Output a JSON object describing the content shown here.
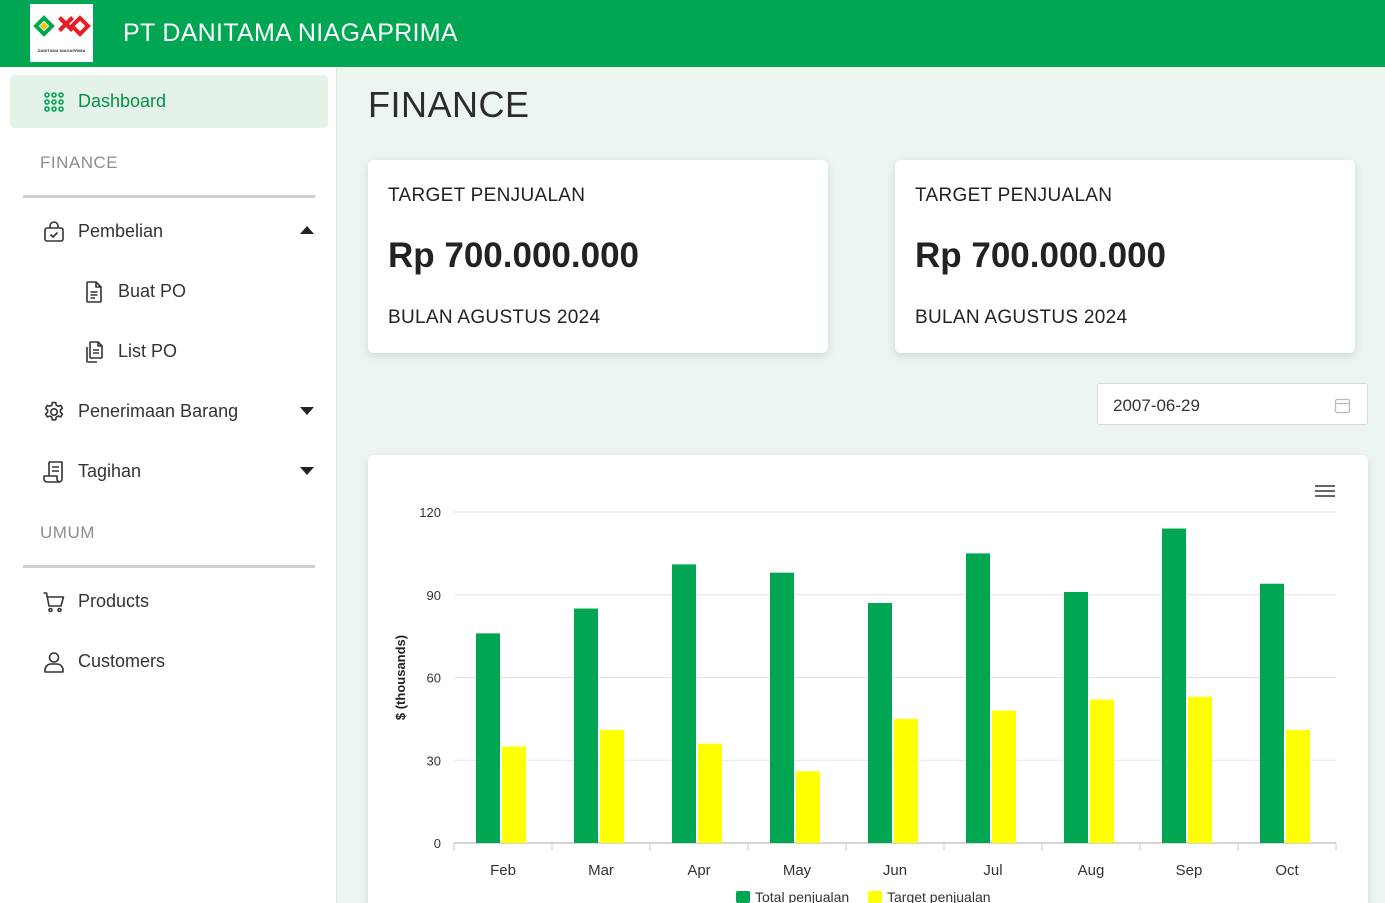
{
  "app": {
    "company_name": "PT DANITAMA NIAGAPRIMA",
    "logo_caption": "DANITAMA NIAGAPRIMA",
    "brand_color": "#00a651"
  },
  "sidebar": {
    "dashboard": {
      "label": "Dashboard",
      "icon": "grid-dots-icon"
    },
    "section_finance": "FINANCE",
    "pembelian": {
      "label": "Pembelian",
      "icon": "shopping-bag-icon",
      "expanded": true
    },
    "buat_po": {
      "label": "Buat PO",
      "icon": "document-icon"
    },
    "list_po": {
      "label": "List PO",
      "icon": "documents-copy-icon"
    },
    "penerimaan": {
      "label": "Penerimaan Barang",
      "icon": "gear-icon",
      "expanded": false
    },
    "tagihan": {
      "label": "Tagihan",
      "icon": "invoice-icon",
      "expanded": false
    },
    "section_umum": "UMUM",
    "products": {
      "label": "Products",
      "icon": "cart-icon"
    },
    "customers": {
      "label": "Customers",
      "icon": "user-icon"
    }
  },
  "main": {
    "page_title": "FINANCE",
    "cards": [
      {
        "title": "TARGET PENJUALAN",
        "amount": "Rp 700.000.000",
        "period": "BULAN AGUSTUS 2024"
      },
      {
        "title": "TARGET PENJUALAN",
        "amount": "Rp 700.000.000",
        "period": "BULAN AGUSTUS 2024"
      }
    ],
    "date_value": "2007-06-29",
    "chart_menu_icon": "hamburger-menu-icon"
  },
  "chart_data": {
    "type": "bar",
    "categories": [
      "Feb",
      "Mar",
      "Apr",
      "May",
      "Jun",
      "Jul",
      "Aug",
      "Sep",
      "Oct"
    ],
    "series": [
      {
        "name": "Total penjualan",
        "color": "#00a651",
        "values": [
          76,
          85,
          101,
          98,
          87,
          105,
          91,
          114,
          94
        ]
      },
      {
        "name": "Target penjualan",
        "color": "#ffff00",
        "values": [
          35,
          41,
          36,
          26,
          45,
          48,
          52,
          53,
          41
        ]
      }
    ],
    "ylabel": "$ (thousands)",
    "xlabel": "",
    "ylim": [
      0,
      120
    ],
    "yticks": [
      0,
      30,
      60,
      90,
      120
    ],
    "grid": true,
    "legend": "bottom-center"
  }
}
